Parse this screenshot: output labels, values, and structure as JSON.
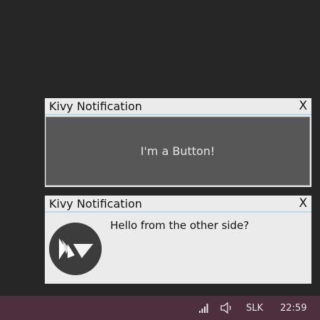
{
  "notifications": [
    {
      "title": "Kivy Notification",
      "close_label": "X",
      "button_label": "I'm a Button!"
    },
    {
      "title": "Kivy Notification",
      "close_label": "X",
      "message": "Hello from the other side?",
      "icon": "kivy-logo-icon"
    }
  ],
  "taskbar": {
    "language": "SLK",
    "time": "22:59",
    "icons": [
      "network-signal-icon",
      "volume-icon"
    ]
  },
  "colors": {
    "desktop": "#262626",
    "notification_bg": "#ebebeb",
    "titlebar_accent": "#bcd9e8",
    "button_bg": "#575757",
    "taskbar_bg": "#4e2f3d"
  }
}
